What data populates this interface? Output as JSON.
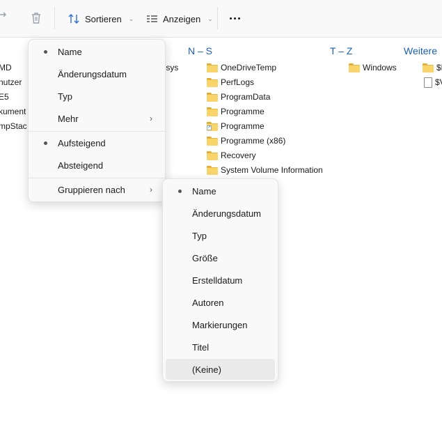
{
  "toolbar": {
    "sort_label": "Sortieren",
    "view_label": "Anzeigen",
    "more_label": "Weitere Optionen"
  },
  "groups": {
    "ns": "N – S",
    "tz": "T – Z",
    "other": "Weitere"
  },
  "left_partial": [
    "MD",
    "nutzer",
    "E5",
    "kument",
    "mpStac"
  ],
  "partial_sys": ".sys",
  "ns_items": [
    "OneDriveTemp",
    "PerfLogs",
    "ProgramData",
    "Programme",
    "Programme",
    "Programme (x86)",
    "Recovery",
    "System Volume Information"
  ],
  "tz_items": [
    "Windows"
  ],
  "other_items": [
    "$R",
    "$V"
  ],
  "sort_menu": {
    "items": [
      "Name",
      "Änderungsdatum",
      "Typ",
      "Mehr"
    ],
    "order": [
      "Aufsteigend",
      "Absteigend"
    ],
    "group_by": "Gruppieren nach"
  },
  "group_menu": {
    "items": [
      "Name",
      "Änderungsdatum",
      "Typ",
      "Größe",
      "Erstelldatum",
      "Autoren",
      "Markierungen",
      "Titel",
      "(Keine)"
    ]
  }
}
